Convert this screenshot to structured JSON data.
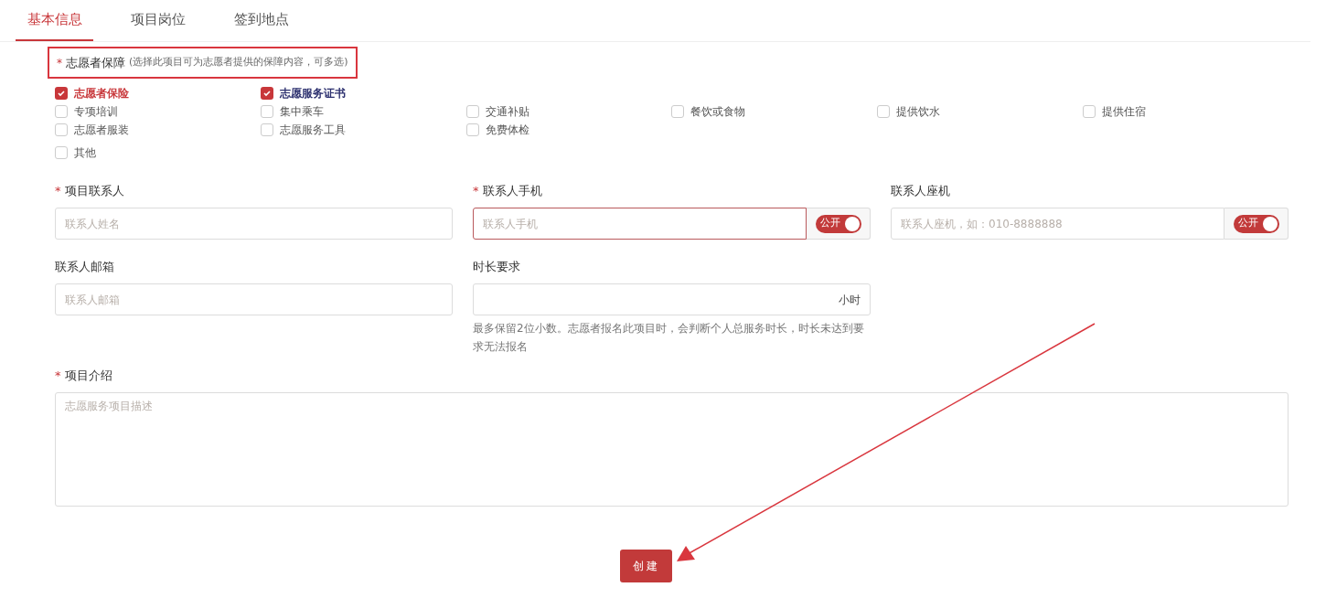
{
  "tabs": [
    {
      "label": "基本信息",
      "selected": true
    },
    {
      "label": "项目岗位",
      "selected": false
    },
    {
      "label": "签到地点",
      "selected": false
    }
  ],
  "guarantee": {
    "required_mark": "*",
    "label": "志愿者保障",
    "note": "(选择此项目可为志愿者提供的保障内容，可多选)",
    "highlighted": true,
    "rows": [
      [
        {
          "label": "志愿者保险",
          "checked": true,
          "color": "#c8373a"
        },
        {
          "label": "志愿服务证书",
          "checked": true,
          "color": "#2b2f6e"
        }
      ],
      [
        {
          "label": "专项培训",
          "checked": false
        },
        {
          "label": "集中乘车",
          "checked": false
        },
        {
          "label": "交通补贴",
          "checked": false
        },
        {
          "label": "餐饮或食物",
          "checked": false
        },
        {
          "label": "提供饮水",
          "checked": false
        },
        {
          "label": "提供住宿",
          "checked": false
        }
      ],
      [
        {
          "label": "志愿者服装",
          "checked": false
        },
        {
          "label": "志愿服务工具",
          "checked": false
        },
        {
          "label": "免费体检",
          "checked": false
        }
      ],
      [
        {
          "label": "其他",
          "checked": false
        }
      ]
    ]
  },
  "fields": [
    {
      "kind": "text",
      "required": true,
      "label": "项目联系人",
      "placeholder": "联系人姓名"
    },
    {
      "kind": "toggle",
      "required": true,
      "label": "联系人手机",
      "placeholder": "联系人手机",
      "invalid": true,
      "toggle": {
        "label": "公开",
        "on": true
      }
    },
    {
      "kind": "toggle",
      "required": false,
      "label": "联系人座机",
      "placeholder": "联系人座机，如：010-8888888",
      "toggle": {
        "label": "公开",
        "on": true
      }
    },
    {
      "kind": "text",
      "required": false,
      "label": "联系人邮箱",
      "placeholder": "联系人邮箱"
    },
    {
      "kind": "unit",
      "required": false,
      "label": "时长要求",
      "unit": "小时",
      "hint": "最多保留2位小数。志愿者报名此项目时，会判断个人总服务时长，时长未达到要求无法报名"
    }
  ],
  "intro": {
    "required": true,
    "label": "项目介绍",
    "placeholder": "志愿服务项目描述"
  },
  "submit": "创建"
}
